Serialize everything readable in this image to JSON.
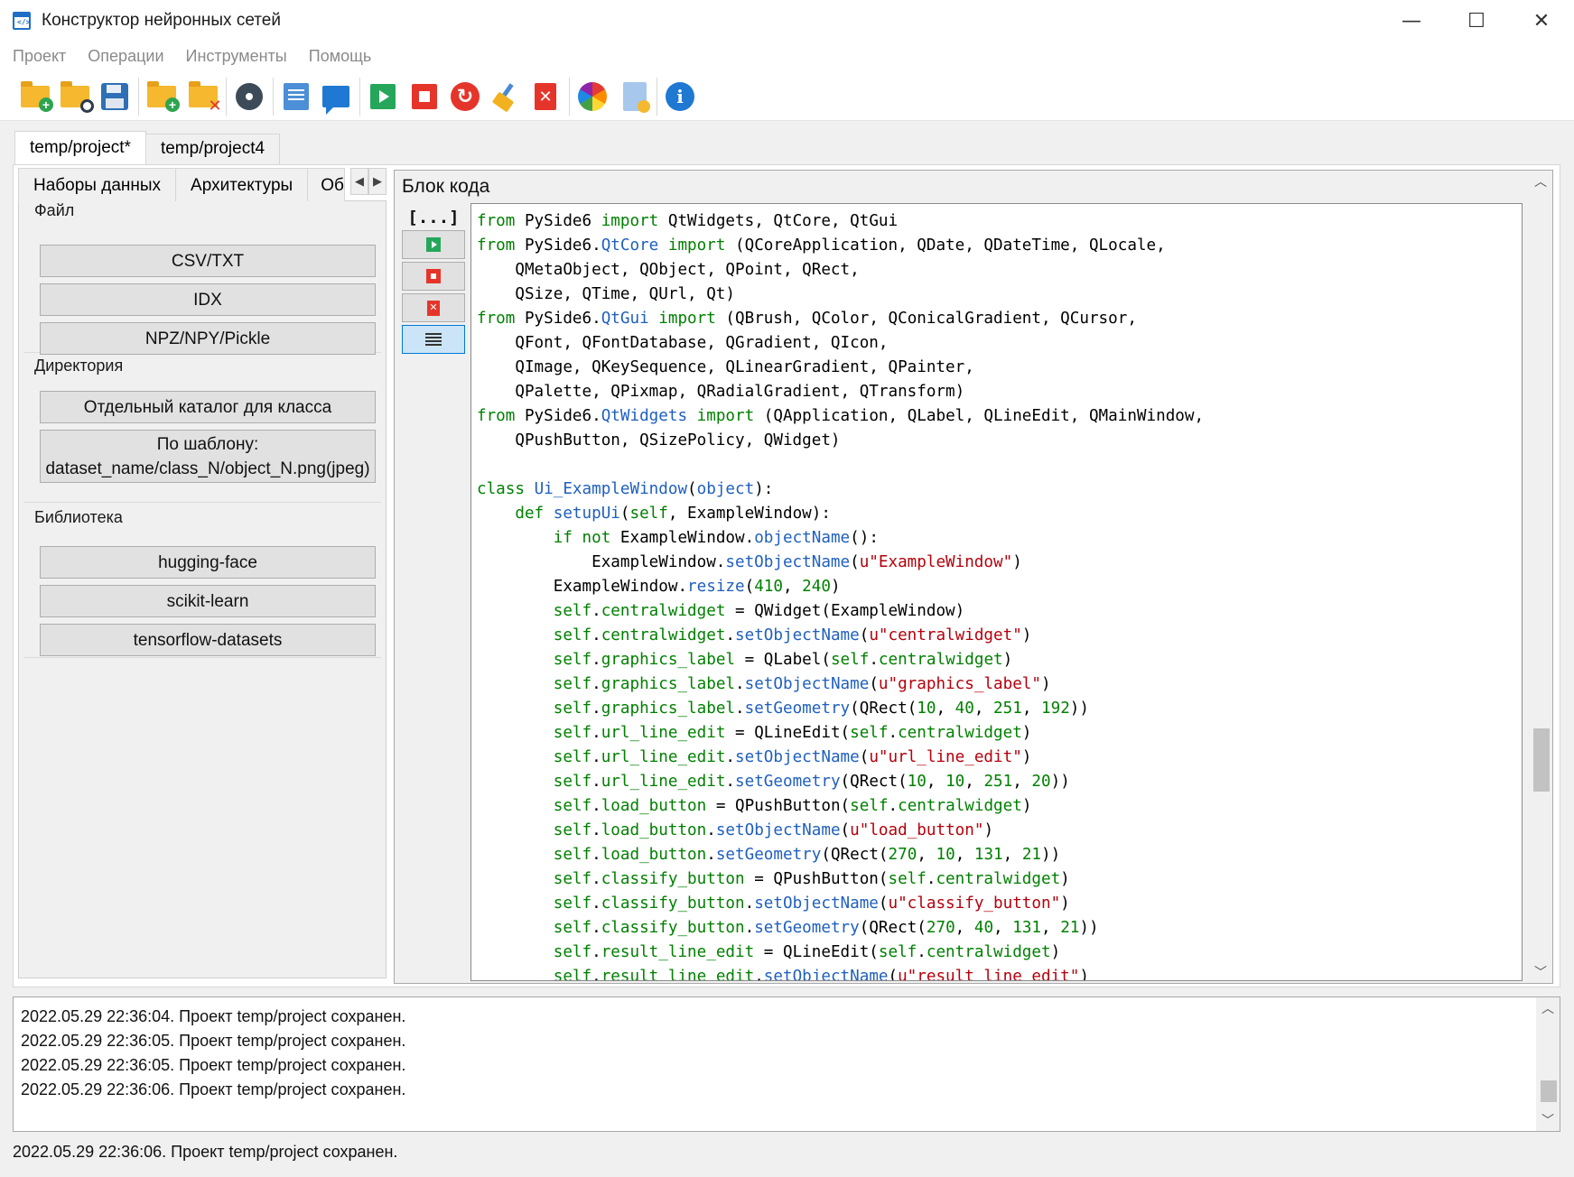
{
  "window": {
    "title": "Конструктор нейронных сетей",
    "icon": "code-window-icon",
    "controls": {
      "minimize": "—",
      "maximize": "☐",
      "close": "✕"
    }
  },
  "menu": [
    "Проект",
    "Операции",
    "Инструменты",
    "Помощь"
  ],
  "toolbar": {
    "icons": [
      "new-folder-icon",
      "open-folder-icon",
      "save-icon",
      "add-folder-icon",
      "remove-folder-icon",
      "settings-icon",
      "text-document-icon",
      "comment-icon",
      "run-icon",
      "stop-icon",
      "restart-icon",
      "clear-icon",
      "delete-icon",
      "color-palette-icon",
      "file-settings-icon",
      "info-icon"
    ]
  },
  "project_tabs": [
    "temp/project*",
    "temp/project4"
  ],
  "left_tabs": [
    "Наборы данных",
    "Архитектуры",
    "Об"
  ],
  "groups": {
    "file": {
      "label": "Файл",
      "buttons": [
        "CSV/TXT",
        "IDX",
        "NPZ/NPY/Pickle"
      ]
    },
    "directory": {
      "label": "Директория",
      "buttons": [
        "Отдельный каталог для класса",
        "По шаблону:\ndataset_name/class_N/object_N.png(jpeg)"
      ]
    },
    "library": {
      "label": "Библиотека",
      "buttons": [
        "hugging-face",
        "scikit-learn",
        "tensorflow-datasets"
      ]
    }
  },
  "code_block": {
    "title": "Блок кода",
    "collapse_label": "[...]",
    "lines": [
      "from PySide6 import QtWidgets, QtCore, QtGui",
      "from PySide6.QtCore import (QCoreApplication, QDate, QDateTime, QLocale,",
      "    QMetaObject, QObject, QPoint, QRect,",
      "    QSize, QTime, QUrl, Qt)",
      "from PySide6.QtGui import (QBrush, QColor, QConicalGradient, QCursor,",
      "    QFont, QFontDatabase, QGradient, QIcon,",
      "    QImage, QKeySequence, QLinearGradient, QPainter,",
      "    QPalette, QPixmap, QRadialGradient, QTransform)",
      "from PySide6.QtWidgets import (QApplication, QLabel, QLineEdit, QMainWindow,",
      "    QPushButton, QSizePolicy, QWidget)",
      "",
      "class Ui_ExampleWindow(object):",
      "    def setupUi(self, ExampleWindow):",
      "        if not ExampleWindow.objectName():",
      "            ExampleWindow.setObjectName(u\"ExampleWindow\")",
      "        ExampleWindow.resize(410, 240)",
      "        self.centralwidget = QWidget(ExampleWindow)",
      "        self.centralwidget.setObjectName(u\"centralwidget\")",
      "        self.graphics_label = QLabel(self.centralwidget)",
      "        self.graphics_label.setObjectName(u\"graphics_label\")",
      "        self.graphics_label.setGeometry(QRect(10, 40, 251, 192))",
      "        self.url_line_edit = QLineEdit(self.centralwidget)",
      "        self.url_line_edit.setObjectName(u\"url_line_edit\")",
      "        self.url_line_edit.setGeometry(QRect(10, 10, 251, 20))",
      "        self.load_button = QPushButton(self.centralwidget)",
      "        self.load_button.setObjectName(u\"load_button\")",
      "        self.load_button.setGeometry(QRect(270, 10, 131, 21))",
      "        self.classify_button = QPushButton(self.centralwidget)",
      "        self.classify_button.setObjectName(u\"classify_button\")",
      "        self.classify_button.setGeometry(QRect(270, 40, 131, 21))",
      "        self.result_line_edit = QLineEdit(self.centralwidget)",
      "        self.result_line_edit.setObjectName(u\"result_line_edit\")"
    ]
  },
  "log": [
    "2022.05.29 22:36:04. Проект temp/project сохранен.",
    "2022.05.29 22:36:05. Проект temp/project сохранен.",
    "2022.05.29 22:36:05. Проект temp/project сохранен.",
    "2022.05.29 22:36:06. Проект temp/project сохранен."
  ],
  "status": "2022.05.29 22:36:06. Проект temp/project сохранен.",
  "colors": {
    "keyword": "#008000",
    "function": "#1f5fbf",
    "string": "#b5000b",
    "accent": "#0078d7"
  }
}
